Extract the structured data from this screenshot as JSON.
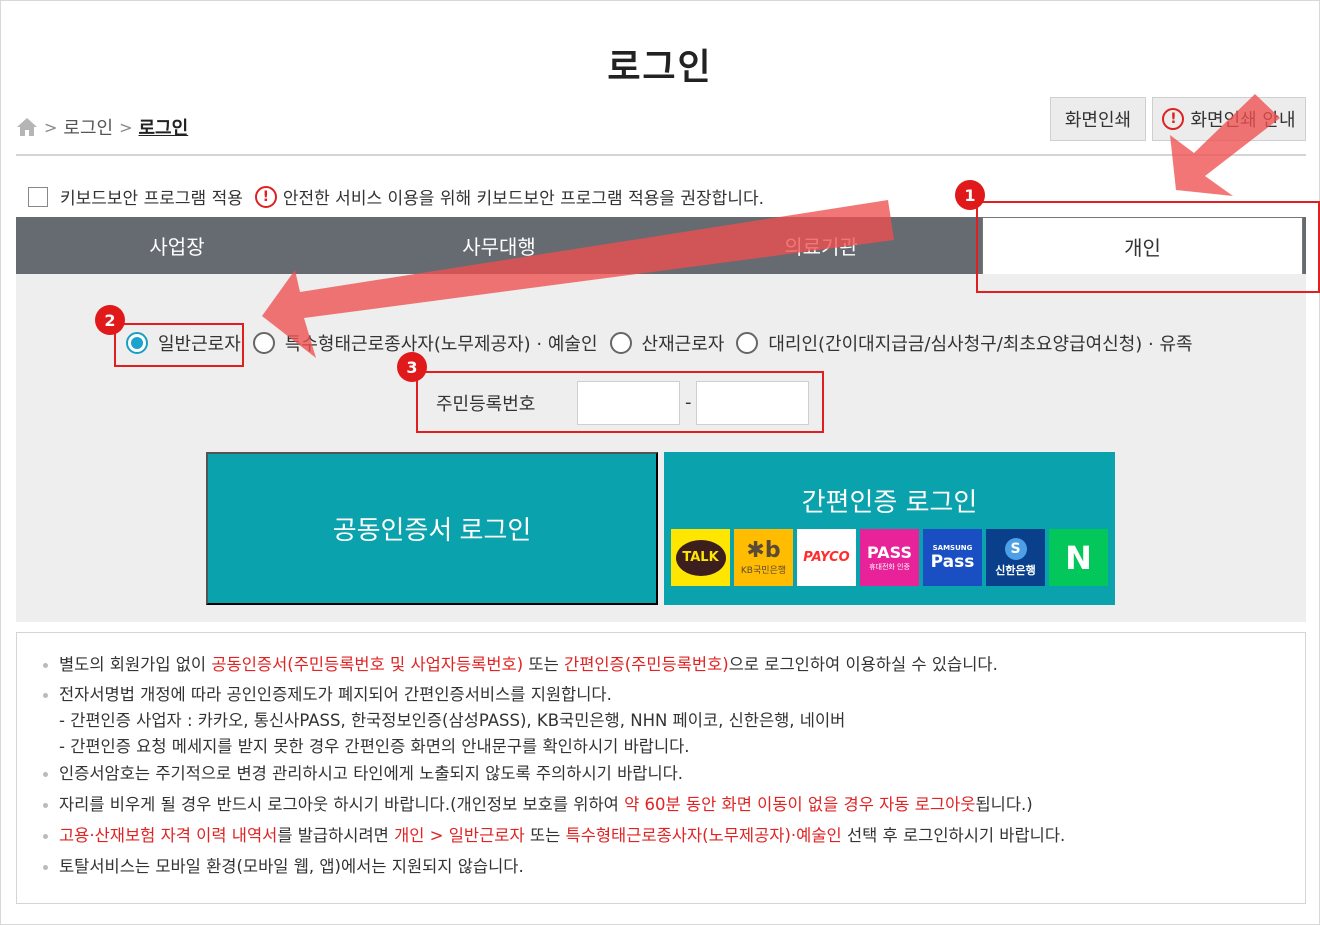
{
  "page": {
    "title": "로그인"
  },
  "breadcrumb": {
    "items": [
      "로그인",
      "로그인"
    ]
  },
  "top_buttons": {
    "print": "화면인쇄",
    "print_guide": "화면인쇄 안내"
  },
  "keyboard_security": {
    "label": "키보드보안 프로그램 적용",
    "notice": "안전한 서비스 이용을 위해 키보드보안 프로그램 적용을 권장합니다."
  },
  "tabs": [
    {
      "label": "사업장"
    },
    {
      "label": "사무대행"
    },
    {
      "label": "의료기관"
    },
    {
      "label": "개인"
    }
  ],
  "user_types": [
    {
      "label": "일반근로자",
      "selected": true
    },
    {
      "label": "특수형태근로종사자(노무제공자) · 예술인",
      "selected": false
    },
    {
      "label": "산재근로자",
      "selected": false
    },
    {
      "label": "대리인(간이대지급금/심사청구/최초요양급여신청) · 유족",
      "selected": false
    }
  ],
  "rrn": {
    "label": "주민등록번호",
    "separator": "-",
    "front_value": "",
    "back_value": ""
  },
  "login": {
    "cert_button": "공동인증서 로그인",
    "simple_title": "간편인증 로그인",
    "providers": [
      {
        "name": "kakao",
        "text": "TALK",
        "bg": "#ffe600",
        "fg": "#3c1e1e"
      },
      {
        "name": "kb",
        "text": "KB국민은행",
        "mark": "✱b",
        "bg": "#ffbc00",
        "fg": "#5b4a36"
      },
      {
        "name": "payco",
        "text": "PAYCO",
        "bg": "#ffffff",
        "fg": "#ff2d2d"
      },
      {
        "name": "pass",
        "text": "PASS",
        "sub": "휴대전화 인증",
        "bg": "#e8239a",
        "fg": "#ffffff"
      },
      {
        "name": "samsung-pass",
        "text": "Pass",
        "sub": "SAMSUNG",
        "bg": "#1a4fc4",
        "fg": "#ffffff"
      },
      {
        "name": "shinhan",
        "text": "신한은행",
        "bg": "#0a3f8c",
        "fg": "#ffffff"
      },
      {
        "name": "naver",
        "text": "N",
        "bg": "#03c75a",
        "fg": "#ffffff"
      }
    ]
  },
  "annotations": [
    "1",
    "2",
    "3"
  ],
  "notice": {
    "l1": {
      "a": "별도의 회원가입 없이 ",
      "b": "공동인증서(주민등록번호 및 사업자등록번호)",
      "c": " 또는 ",
      "d": "간편인증(주민등록번호)",
      "e": "으로 로그인하여 이용하실 수 있습니다."
    },
    "l2": "전자서명법 개정에 따라 공인인증제도가 폐지되어 간편인증서비스를 지원합니다.",
    "l2a": "- 간편인증 사업자 : 카카오, 통신사PASS, 한국정보인증(삼성PASS), KB국민은행, NHN 페이코, 신한은행, 네이버",
    "l2b": "- 간편인증 요청 메세지를 받지 못한 경우 간편인증 화면의 안내문구를 확인하시기 바랍니다.",
    "l3": "인증서암호는 주기적으로 변경 관리하시고 타인에게 노출되지 않도록 주의하시기 바랍니다.",
    "l4": {
      "a": "자리를 비우게 될 경우 반드시 로그아웃 하시기 바랍니다.(개인정보 보호를 위하여 ",
      "b": "약 60분 동안 화면 이동이 없을 경우 자동 로그아웃",
      "c": "됩니다.)"
    },
    "l5": {
      "a": "고용·산재보험 자격 이력 내역서",
      "b": "를 발급하시려면 ",
      "c": "개인 > 일반근로자",
      "d": " 또는 ",
      "e": "특수형태근로종사자(노무제공자)·예술인",
      "f": " 선택 후 로그인하시기 바랍니다."
    },
    "l6": "토탈서비스는 모바일 환경(모바일 웹, 앱)에서는 지원되지 않습니다."
  },
  "colors": {
    "teal": "#0aa2ac",
    "tab_bar": "#666b72",
    "annotation_red": "#e02020"
  }
}
